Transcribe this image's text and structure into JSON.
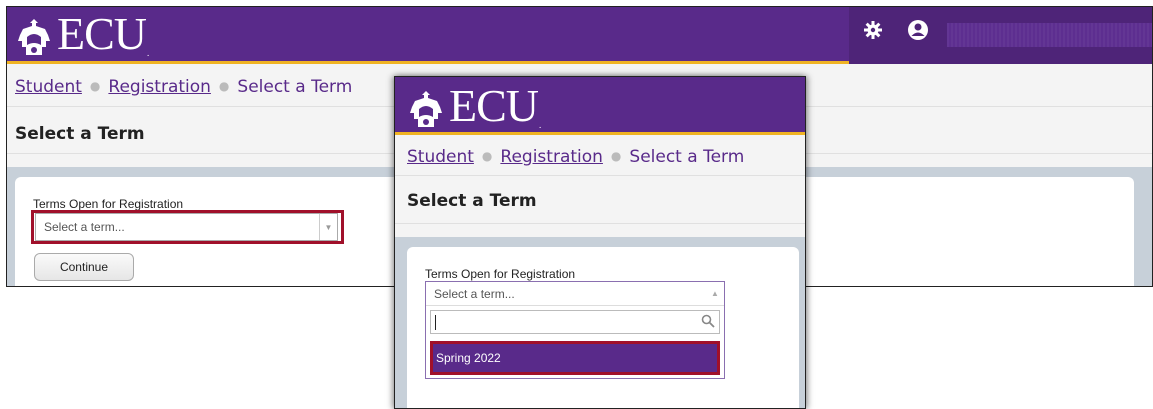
{
  "brand": {
    "name": "ECU",
    "reg_mark": "."
  },
  "colors": {
    "purple": "#592a8a",
    "gold": "#f0b323",
    "highlight": "#a0102a"
  },
  "icons": {
    "settings": "gear-icon",
    "account": "user-icon",
    "search": "search-icon",
    "logo": "ecu-crest-icon"
  },
  "back": {
    "breadcrumb": {
      "item1": "Student",
      "item2": "Registration",
      "current": "Select a Term"
    },
    "page_title": "Select a Term",
    "field_label": "Terms Open for Registration",
    "select_placeholder": "Select a term...",
    "continue_label": "Continue"
  },
  "front": {
    "breadcrumb": {
      "item1": "Student",
      "item2": "Registration",
      "current": "Select a Term"
    },
    "page_title": "Select a Term",
    "field_label": "Terms Open for Registration",
    "select_placeholder": "Select a term...",
    "search_value": "",
    "options": [
      "Spring 2022"
    ]
  }
}
